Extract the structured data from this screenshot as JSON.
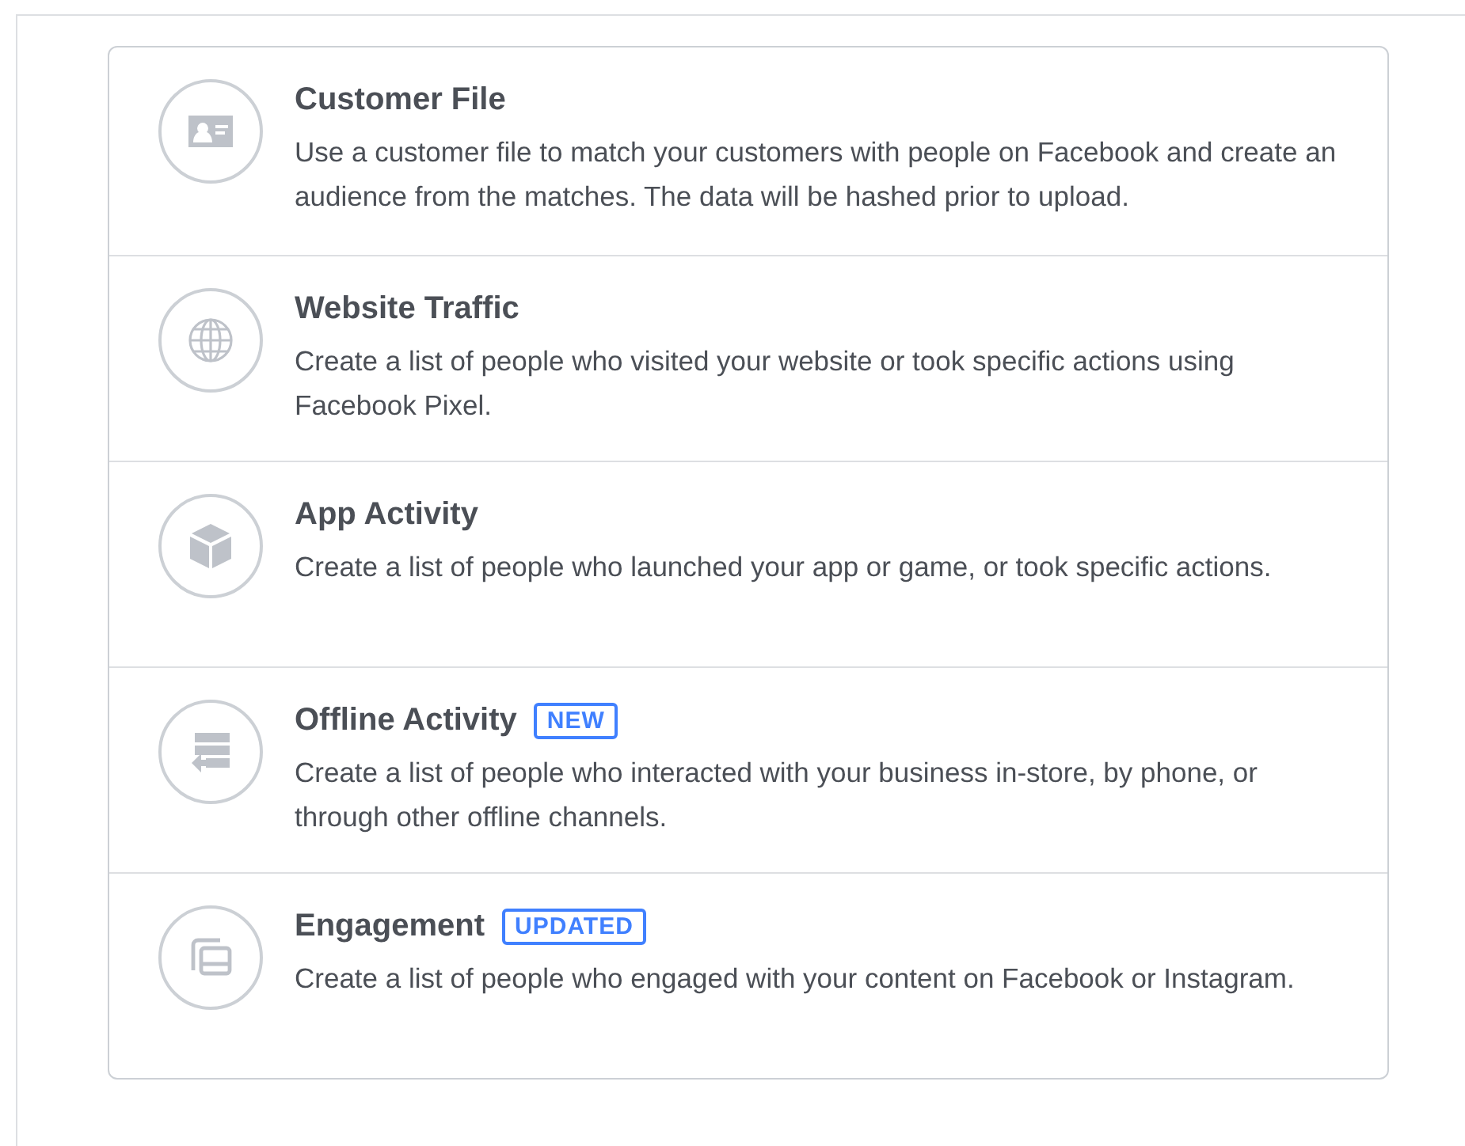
{
  "options": [
    {
      "kind": "customer-file",
      "title": "Customer File",
      "description": "Use a customer file to match your customers with people on Facebook and create an audience from the matches. The data will be hashed prior to upload."
    },
    {
      "kind": "website",
      "title": "Website Traffic",
      "description": "Create a list of people who visited your website or took specific actions using Facebook Pixel."
    },
    {
      "kind": "app",
      "title": "App Activity",
      "description": "Create a list of people who launched your app or game, or took specific actions."
    },
    {
      "kind": "offline",
      "title": "Offline Activity",
      "badge": "NEW",
      "description": "Create a list of people who interacted with your business in-store, by phone, or through other offline channels."
    },
    {
      "kind": "engagement",
      "title": "Engagement",
      "badge": "UPDATED",
      "description": "Create a list of people who engaged with your content on Facebook or Instagram."
    }
  ]
}
